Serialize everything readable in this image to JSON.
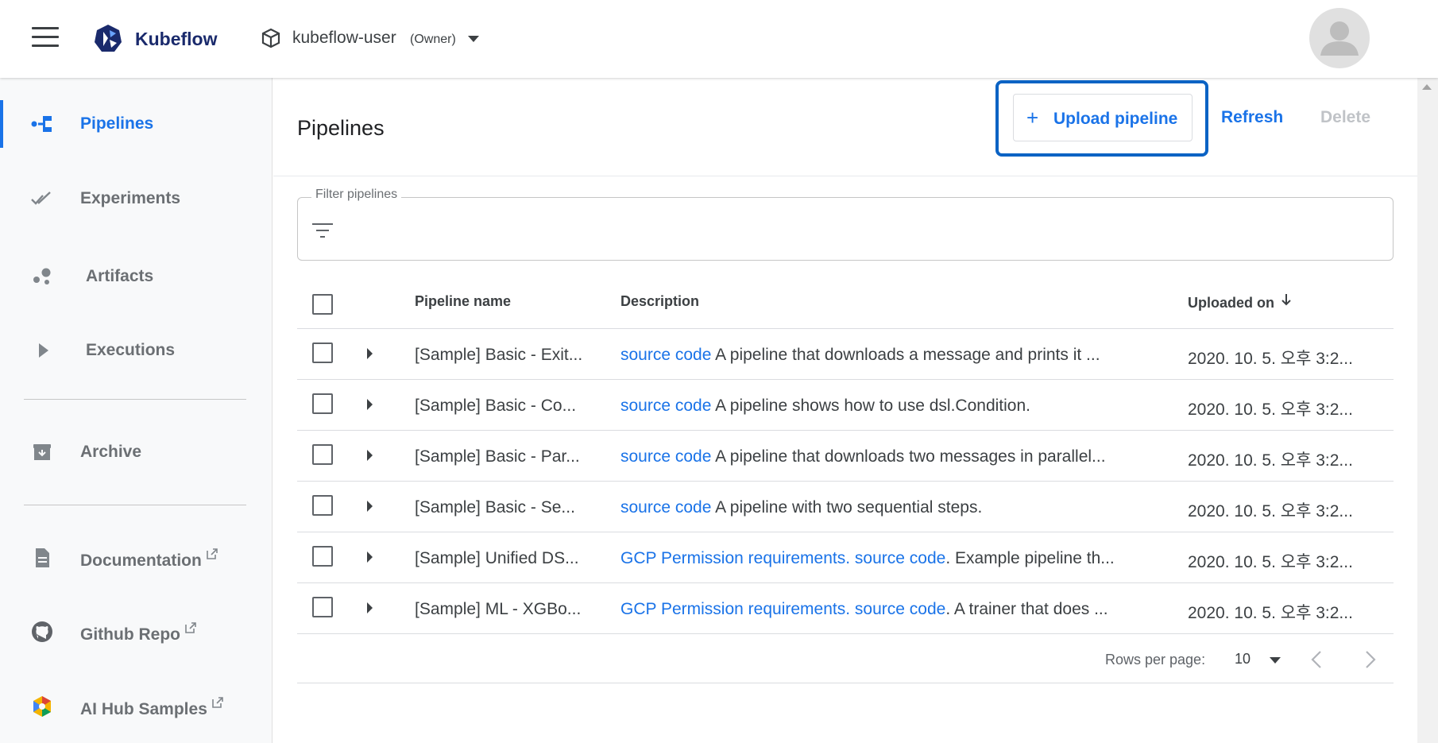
{
  "header": {
    "app_name": "Kubeflow",
    "namespace": "kubeflow-user",
    "namespace_role": "(Owner)"
  },
  "sidebar": {
    "items": [
      {
        "label": "Pipelines",
        "icon": "pipelines-icon",
        "active": true
      },
      {
        "label": "Experiments",
        "icon": "experiments-icon"
      },
      {
        "label": "Artifacts",
        "icon": "artifacts-icon"
      },
      {
        "label": "Executions",
        "icon": "executions-icon"
      },
      {
        "label": "Archive",
        "icon": "archive-icon"
      },
      {
        "label": "Documentation",
        "icon": "document-icon",
        "external": true
      },
      {
        "label": "Github Repo",
        "icon": "github-icon",
        "external": true
      },
      {
        "label": "AI Hub Samples",
        "icon": "ai-hub-icon",
        "external": true
      }
    ]
  },
  "main": {
    "title": "Pipelines",
    "upload_label": "Upload pipeline",
    "refresh_label": "Refresh",
    "delete_label": "Delete",
    "filter_label": "Filter pipelines"
  },
  "table": {
    "columns": [
      "Pipeline name",
      "Description",
      "Uploaded on"
    ],
    "rows": [
      {
        "name": "[Sample] Basic - Exit...",
        "links": [
          "source code"
        ],
        "text": " A pipeline that downloads a message and prints it ...",
        "date": "2020. 10. 5. 오후 3:2..."
      },
      {
        "name": "[Sample] Basic - Co...",
        "links": [
          "source code"
        ],
        "text": " A pipeline shows how to use dsl.Condition.",
        "date": "2020. 10. 5. 오후 3:2..."
      },
      {
        "name": "[Sample] Basic - Par...",
        "links": [
          "source code"
        ],
        "text": " A pipeline that downloads two messages in parallel...",
        "date": "2020. 10. 5. 오후 3:2..."
      },
      {
        "name": "[Sample] Basic - Se...",
        "links": [
          "source code"
        ],
        "text": " A pipeline with two sequential steps.",
        "date": "2020. 10. 5. 오후 3:2..."
      },
      {
        "name": "[Sample] Unified DS...",
        "links": [
          "GCP Permission requirements.",
          "source code"
        ],
        "text": ". Example pipeline th...",
        "date": "2020. 10. 5. 오후 3:2..."
      },
      {
        "name": "[Sample] ML - XGBo...",
        "links": [
          "GCP Permission requirements.",
          "source code"
        ],
        "text": ". A trainer that does ...",
        "date": "2020. 10. 5. 오후 3:2..."
      }
    ]
  },
  "pagination": {
    "rows_per_page_label": "Rows per page:",
    "rows_per_page": "10"
  },
  "colors": {
    "accent": "#1a73e8",
    "highlight": "#0b63c4"
  }
}
